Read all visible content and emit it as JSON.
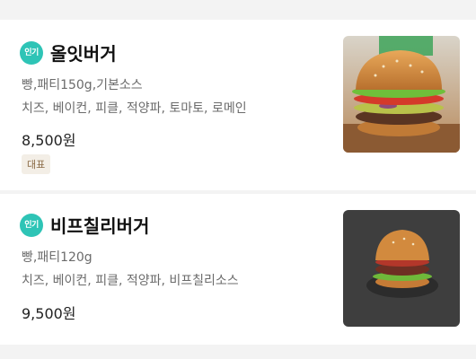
{
  "menu_items": [
    {
      "badge": "인기",
      "name": "올잇버거",
      "desc_line1": "빵,패티150g,기본소스",
      "desc_line2": "치즈, 베이컨, 피클, 적양파, 토마토, 로메인",
      "price": "8,500원",
      "tag": "대표",
      "image_icon": "burger-photo"
    },
    {
      "badge": "인기",
      "name": "비프칠리버거",
      "desc_line1": "빵,패티120g",
      "desc_line2": "치즈, 베이컨, 피클, 적양파, 비프칠리소스",
      "price": "9,500원",
      "image_icon": "burger-photo"
    }
  ],
  "colors": {
    "badge": "#2ec4b6",
    "tag_bg": "#f3eee6",
    "tag_text": "#8a6a45"
  }
}
